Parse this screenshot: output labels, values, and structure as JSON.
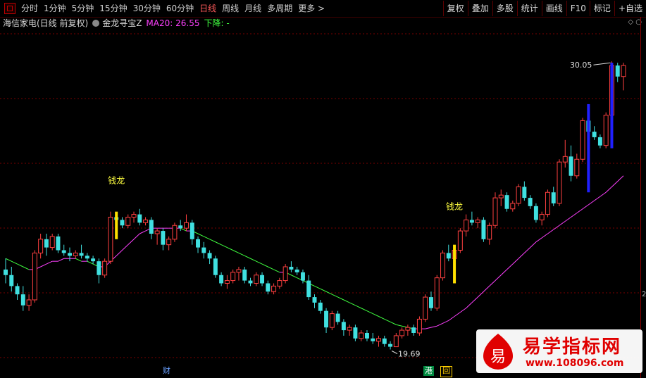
{
  "toolbar": {
    "periods": [
      "分时",
      "1分钟",
      "5分钟",
      "15分钟",
      "30分钟",
      "60分钟",
      "日线",
      "周线",
      "月线",
      "多周期",
      "更多 >"
    ],
    "active_period": "日线",
    "right_buttons": [
      "复权",
      "叠加",
      "多股",
      "统计",
      "画线",
      "F10",
      "标记",
      "+自选"
    ]
  },
  "info": {
    "stock_title": "海信家电(日线 前复权)",
    "indicator_name": "金龙寻宝Z",
    "ma_label": "MA20: 26.55",
    "trend": "下降: -"
  },
  "chart": {
    "annotations": [
      {
        "text": "钱龙",
        "color": "#ffff40"
      },
      {
        "text": "钱龙",
        "color": "#ffff40"
      }
    ],
    "high_label": "30.05",
    "low_label": "19.69",
    "axis_tag": "2",
    "colors": {
      "up": "#ff4040",
      "down": "#40e0e0",
      "ma_rise": "#ff40ff",
      "ma_fall": "#40ff40",
      "grid": "#7a0000",
      "signal": "#ffe000",
      "blue": "#2020ff"
    }
  },
  "chart_data": {
    "type": "candlestick",
    "title": "海信家电(日线 前复权)",
    "indicator": "MA20",
    "ma20_last": 26.55,
    "ylim": [
      19.0,
      31.0
    ],
    "candles": [
      [
        22.5,
        22.9,
        22.0,
        22.3
      ],
      [
        22.3,
        22.6,
        21.7,
        21.9
      ],
      [
        21.9,
        22.0,
        21.4,
        21.6
      ],
      [
        21.6,
        21.9,
        21.0,
        21.2
      ],
      [
        21.2,
        21.6,
        21.0,
        21.4
      ],
      [
        21.4,
        23.2,
        21.3,
        23.1
      ],
      [
        23.1,
        23.8,
        22.9,
        23.6
      ],
      [
        23.6,
        23.8,
        23.0,
        23.3
      ],
      [
        23.3,
        23.8,
        23.2,
        23.7
      ],
      [
        23.7,
        23.8,
        23.1,
        23.2
      ],
      [
        23.2,
        23.4,
        23.0,
        23.1
      ],
      [
        23.1,
        23.3,
        22.8,
        23.0
      ],
      [
        23.0,
        23.2,
        22.9,
        23.1
      ],
      [
        23.1,
        23.4,
        22.9,
        23.0
      ],
      [
        23.0,
        23.1,
        22.8,
        22.9
      ],
      [
        22.9,
        23.0,
        22.7,
        22.8
      ],
      [
        22.8,
        22.9,
        22.0,
        22.3
      ],
      [
        22.3,
        22.9,
        22.2,
        22.8
      ],
      [
        22.8,
        24.6,
        22.7,
        24.4
      ],
      [
        24.4,
        24.5,
        24.1,
        24.3
      ],
      [
        24.3,
        24.4,
        24.0,
        24.1
      ],
      [
        24.1,
        24.5,
        24.0,
        24.4
      ],
      [
        24.4,
        24.6,
        24.2,
        24.5
      ],
      [
        24.5,
        24.7,
        24.1,
        24.2
      ],
      [
        24.2,
        24.4,
        24.1,
        24.3
      ],
      [
        24.3,
        24.4,
        23.6,
        23.8
      ],
      [
        23.8,
        24.0,
        23.4,
        23.9
      ],
      [
        23.9,
        24.0,
        23.2,
        23.4
      ],
      [
        23.4,
        23.7,
        23.2,
        23.6
      ],
      [
        23.6,
        24.2,
        23.5,
        24.1
      ],
      [
        24.1,
        24.3,
        23.9,
        24.0
      ],
      [
        24.0,
        24.5,
        23.9,
        24.2
      ],
      [
        24.2,
        24.3,
        23.4,
        23.6
      ],
      [
        23.6,
        23.7,
        23.1,
        23.3
      ],
      [
        23.3,
        23.5,
        22.9,
        23.1
      ],
      [
        23.1,
        23.2,
        22.7,
        22.9
      ],
      [
        22.9,
        23.0,
        22.2,
        22.3
      ],
      [
        22.3,
        22.4,
        21.9,
        22.0
      ],
      [
        22.0,
        22.3,
        21.8,
        22.1
      ],
      [
        22.1,
        22.5,
        22.0,
        22.4
      ],
      [
        22.4,
        22.6,
        22.1,
        22.5
      ],
      [
        22.5,
        22.6,
        22.0,
        22.1
      ],
      [
        22.1,
        22.2,
        21.9,
        22.0
      ],
      [
        22.0,
        22.4,
        21.9,
        22.3
      ],
      [
        22.3,
        22.4,
        21.9,
        22.0
      ],
      [
        22.0,
        22.1,
        21.6,
        21.7
      ],
      [
        21.7,
        22.0,
        21.6,
        21.9
      ],
      [
        21.9,
        22.2,
        21.8,
        22.1
      ],
      [
        22.1,
        22.7,
        22.0,
        22.6
      ],
      [
        22.6,
        22.8,
        22.4,
        22.5
      ],
      [
        22.5,
        22.6,
        22.3,
        22.4
      ],
      [
        22.4,
        22.5,
        22.0,
        22.1
      ],
      [
        22.1,
        22.3,
        21.4,
        21.5
      ],
      [
        21.5,
        21.6,
        21.1,
        21.3
      ],
      [
        21.3,
        21.4,
        20.9,
        21.0
      ],
      [
        21.0,
        21.1,
        20.2,
        20.4
      ],
      [
        20.4,
        21.0,
        20.3,
        20.9
      ],
      [
        20.9,
        21.0,
        20.5,
        20.6
      ],
      [
        20.6,
        20.7,
        20.1,
        20.3
      ],
      [
        20.3,
        20.5,
        20.1,
        20.4
      ],
      [
        20.4,
        20.5,
        19.9,
        20.0
      ],
      [
        20.0,
        20.3,
        19.9,
        20.2
      ],
      [
        20.2,
        20.3,
        19.9,
        20.0
      ],
      [
        20.0,
        20.2,
        19.8,
        19.9
      ],
      [
        19.9,
        20.1,
        19.7,
        20.0
      ],
      [
        20.0,
        20.1,
        19.7,
        19.8
      ],
      [
        19.8,
        19.9,
        19.6,
        19.7
      ],
      [
        19.7,
        20.2,
        19.69,
        20.1
      ],
      [
        20.1,
        20.4,
        20.0,
        20.3
      ],
      [
        20.3,
        20.5,
        20.1,
        20.4
      ],
      [
        20.4,
        20.5,
        20.1,
        20.2
      ],
      [
        20.2,
        20.8,
        20.1,
        20.7
      ],
      [
        20.7,
        21.6,
        20.6,
        21.5
      ],
      [
        21.5,
        21.7,
        21.0,
        21.1
      ],
      [
        21.1,
        22.3,
        21.0,
        22.2
      ],
      [
        22.2,
        23.2,
        22.1,
        23.1
      ],
      [
        23.1,
        23.4,
        22.8,
        22.9
      ],
      [
        22.9,
        23.3,
        22.8,
        23.2
      ],
      [
        23.2,
        24.0,
        23.1,
        23.9
      ],
      [
        23.9,
        24.5,
        23.7,
        24.3
      ],
      [
        24.3,
        24.6,
        24.1,
        24.2
      ],
      [
        24.2,
        24.4,
        24.0,
        24.3
      ],
      [
        24.3,
        24.4,
        23.5,
        23.6
      ],
      [
        23.6,
        24.2,
        23.4,
        24.1
      ],
      [
        24.1,
        25.3,
        24.0,
        25.1
      ],
      [
        25.1,
        25.4,
        24.8,
        25.2
      ],
      [
        25.2,
        25.3,
        24.6,
        24.7
      ],
      [
        24.7,
        25.0,
        24.6,
        24.9
      ],
      [
        24.9,
        25.6,
        24.8,
        25.5
      ],
      [
        25.5,
        25.7,
        25.0,
        25.1
      ],
      [
        25.1,
        25.2,
        24.7,
        24.8
      ],
      [
        24.8,
        24.9,
        24.2,
        24.3
      ],
      [
        24.3,
        24.6,
        24.1,
        24.5
      ],
      [
        24.5,
        25.4,
        24.4,
        25.3
      ],
      [
        25.3,
        25.5,
        24.8,
        24.9
      ],
      [
        24.9,
        26.5,
        24.8,
        26.4
      ],
      [
        26.4,
        27.2,
        26.2,
        26.6
      ],
      [
        26.6,
        27.0,
        25.7,
        25.9
      ],
      [
        25.9,
        26.7,
        25.8,
        26.5
      ],
      [
        26.5,
        28.0,
        26.4,
        27.9
      ],
      [
        27.9,
        28.1,
        27.4,
        27.5
      ],
      [
        27.5,
        27.7,
        27.2,
        27.3
      ],
      [
        27.3,
        27.4,
        26.9,
        27.0
      ],
      [
        27.0,
        28.2,
        26.9,
        28.1
      ],
      [
        28.1,
        30.05,
        28.0,
        29.9
      ],
      [
        29.9,
        30.0,
        29.3,
        29.5
      ],
      [
        29.5,
        30.0,
        29.0,
        29.9
      ]
    ],
    "ma20": [
      22.9,
      22.8,
      22.7,
      22.6,
      22.5,
      22.5,
      22.6,
      22.7,
      22.8,
      22.8,
      22.9,
      22.9,
      22.9,
      22.8,
      22.8,
      22.7,
      22.6,
      22.6,
      22.8,
      23.0,
      23.2,
      23.4,
      23.6,
      23.8,
      23.9,
      24.0,
      24.0,
      24.0,
      24.0,
      24.0,
      24.0,
      23.9,
      23.9,
      23.8,
      23.7,
      23.6,
      23.5,
      23.4,
      23.3,
      23.2,
      23.1,
      23.0,
      22.9,
      22.8,
      22.7,
      22.6,
      22.5,
      22.4,
      22.4,
      22.3,
      22.2,
      22.1,
      22.0,
      21.9,
      21.8,
      21.7,
      21.6,
      21.5,
      21.4,
      21.3,
      21.2,
      21.1,
      21.0,
      20.9,
      20.8,
      20.7,
      20.6,
      20.5,
      20.45,
      20.4,
      20.35,
      20.35,
      20.35,
      20.4,
      20.45,
      20.55,
      20.65,
      20.8,
      20.95,
      21.1,
      21.3,
      21.5,
      21.7,
      21.9,
      22.1,
      22.3,
      22.5,
      22.7,
      22.9,
      23.1,
      23.3,
      23.5,
      23.65,
      23.8,
      23.95,
      24.1,
      24.25,
      24.4,
      24.55,
      24.7,
      24.85,
      25.0,
      25.15,
      25.3,
      25.5,
      25.7,
      25.9
    ],
    "signals": [
      {
        "type": "yellow",
        "index": 19,
        "low": 23.6,
        "high": 24.6
      },
      {
        "type": "yellow",
        "index": 77,
        "low": 22.0,
        "high": 23.4
      },
      {
        "type": "blue",
        "index": 100,
        "low": 25.3,
        "high": 28.5
      },
      {
        "type": "blue",
        "index": 104,
        "low": 26.9,
        "high": 30.0
      }
    ]
  },
  "bottom_marks": {
    "cai": "财",
    "gang": "港",
    "hui": "回"
  },
  "watermark": {
    "title": "易学指标网",
    "url": "www.108096.com",
    "logo_char": "易"
  }
}
